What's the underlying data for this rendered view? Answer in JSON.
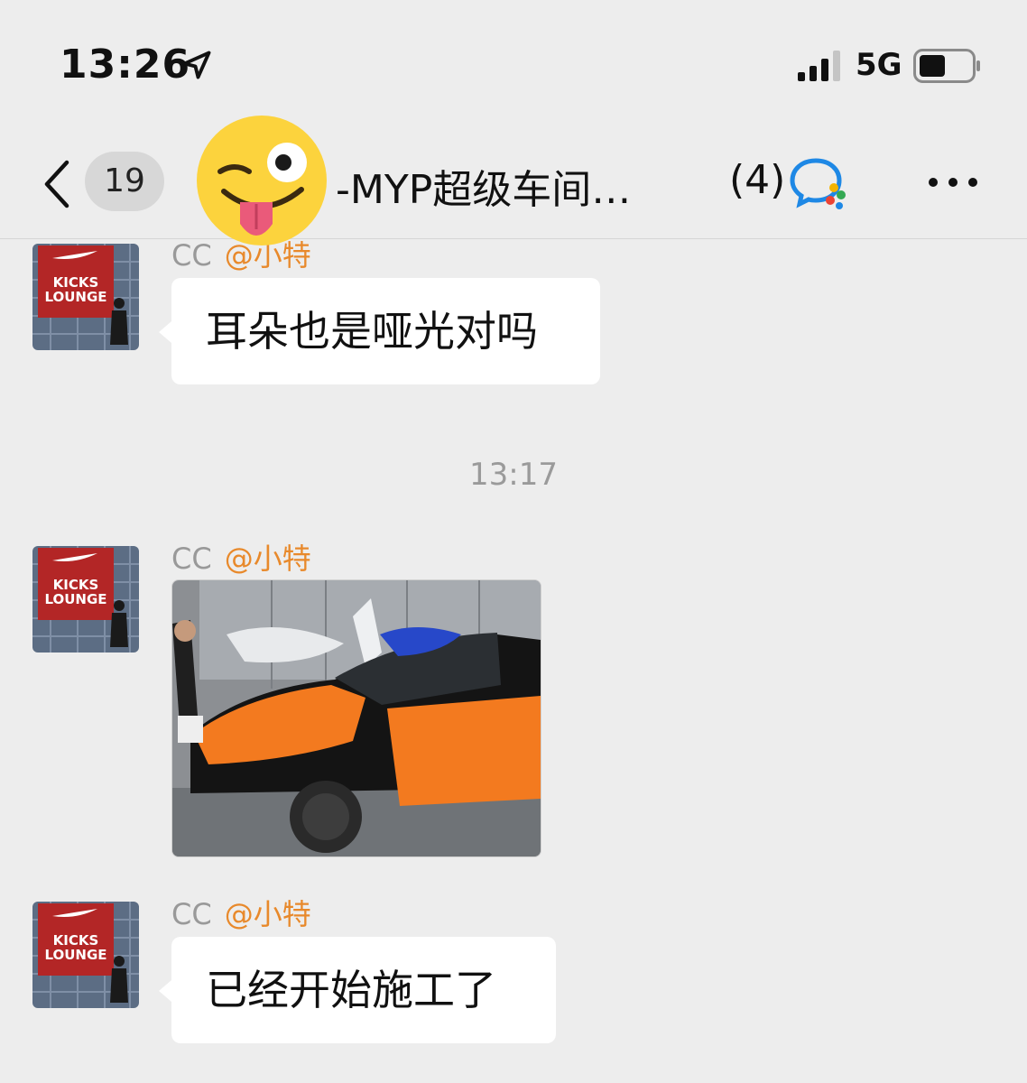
{
  "status_bar": {
    "time": "13:26",
    "network": "5G",
    "icons": [
      "location-arrow-icon",
      "signal-bars-icon",
      "battery-icon"
    ]
  },
  "nav": {
    "unread_count": "19",
    "title": "-MYP超级车间…",
    "member_count": "(4)",
    "icons": [
      "back-chevron-icon",
      "winking-tongue-emoji",
      "wecom-icon",
      "more-dots-icon"
    ]
  },
  "messages": [
    {
      "sender": "CC",
      "mention": "@小特",
      "type": "text",
      "text": "耳朵也是哑光对吗"
    },
    {
      "timestamp": "13:17"
    },
    {
      "sender": "CC",
      "mention": "@小特",
      "type": "image"
    },
    {
      "sender": "CC",
      "mention": "@小特",
      "type": "text",
      "text": "已经开始施工了"
    }
  ],
  "avatar_logo": {
    "line1": "KICKS",
    "line2": "LOUNGE"
  },
  "colors": {
    "background": "#ededed",
    "bubble": "#ffffff",
    "mention": "#e8892b",
    "wrap_orange": "#f37a1f"
  }
}
